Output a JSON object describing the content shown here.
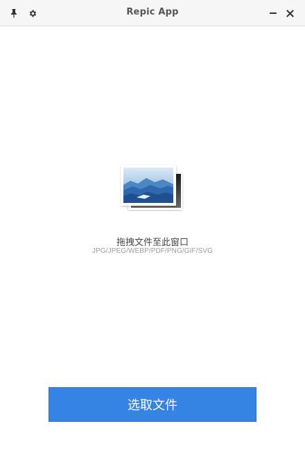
{
  "window": {
    "title": "Repic App"
  },
  "titlebar": {
    "icons": {
      "pin": "pin-icon",
      "settings": "gear-icon",
      "minimize": "minimize-icon",
      "close": "close-icon"
    }
  },
  "dropzone": {
    "icon": "image-icon",
    "hint": "拖拽文件至此窗口",
    "formats": "JPG/JPEG/WEBP/PDF/PNG/GIF/SVG"
  },
  "actions": {
    "select_file_label": "选取文件"
  },
  "colors": {
    "accent": "#3584e4",
    "titlebar_bg": "#f6f6f6",
    "title_text": "#555555"
  }
}
